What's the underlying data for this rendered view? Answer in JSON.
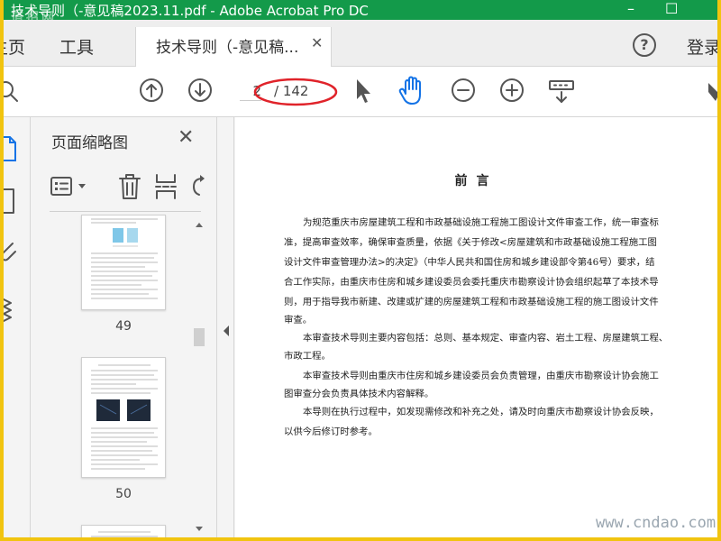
{
  "window": {
    "title": "技术导则（-意见稿2023.11.pdf - Adobe Acrobat Pro DC",
    "logo_watermark": "道招网",
    "minimize": "–",
    "maximize": "☐"
  },
  "tabs": {
    "home": "主页",
    "tools": "工具",
    "document": "技术导则（-意见稿...",
    "close_glyph": "✕",
    "help": "?",
    "login": "登录"
  },
  "toolbar": {
    "current_page": "2",
    "total_pages": "/ 142",
    "highlight_color": "#e0232a"
  },
  "thumbnails_panel": {
    "title": "页面缩略图",
    "close_glyph": "✕",
    "pages": [
      {
        "number": "49"
      },
      {
        "number": "50"
      }
    ]
  },
  "document": {
    "heading": "前言",
    "lines": [
      "为规范重庆市房屋建筑工程和市政基础设施工程施工图设计文件审查工作，统一审查标",
      "准，提高审查效率，确保审查质量，依据《关于修改<房屋建筑和市政基础设施工程施工图",
      "设计文件审查管理办法>的决定》（中华人民共和国住房和城乡建设部令第46号）要求，结",
      "合工作实际，由重庆市住房和城乡建设委员会委托重庆市勘察设计协会组织起草了本技术导",
      "则，用于指导我市新建、改建或扩建的房屋建筑工程和市政基础设施工程的施工图设计文件",
      "审查。",
      "本审查技术导则主要内容包括：总则、基本规定、审查内容、岩土工程、房屋建筑工程、",
      "市政工程。",
      "本审查技术导则由重庆市住房和城乡建设委员会负责管理，由重庆市勘察设计协会施工",
      "图审查分会负责具体技术内容解释。",
      "本导则在执行过程中，如发现需修改和补充之处，请及时向重庆市勘察设计协会反映，",
      "以供今后修订时参考。"
    ]
  },
  "site_watermark": "www.cndao.com",
  "colors": {
    "titlebar": "#139a4a",
    "accent_blue": "#1473e6",
    "frame": "#f1c40f"
  }
}
